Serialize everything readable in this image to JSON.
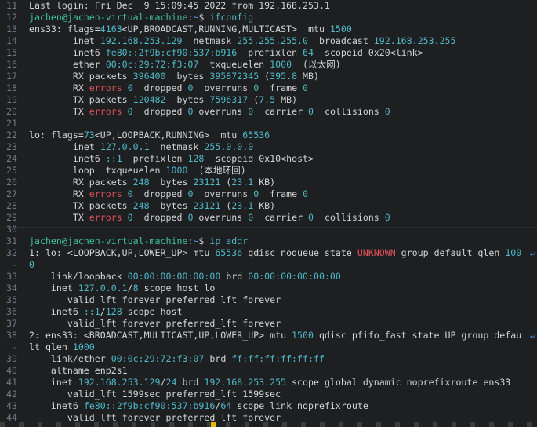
{
  "terminal": {
    "lines": [
      {
        "n": "11",
        "segs": [
          {
            "t": "Last login: Fri Dec  9 15:09:45 2022 from 192.168.253.1"
          }
        ]
      },
      {
        "n": "12",
        "segs": [
          {
            "t": "jachen@jachen-virtual-machine",
            "c": "p"
          },
          {
            "t": ":",
            "c": "sym"
          },
          {
            "t": "~",
            "c": "dir"
          },
          {
            "t": "$ ",
            "c": "sym"
          },
          {
            "t": "ifconfig",
            "c": "n"
          }
        ]
      },
      {
        "n": "13",
        "segs": [
          {
            "t": "ens33: flags="
          },
          {
            "t": "4163",
            "c": "n"
          },
          {
            "t": "<UP,BROADCAST,RUNNING,MULTICAST>  mtu "
          },
          {
            "t": "1500",
            "c": "n"
          }
        ]
      },
      {
        "n": "14",
        "segs": [
          {
            "t": "        inet "
          },
          {
            "t": "192.168.253.129",
            "c": "n"
          },
          {
            "t": "  netmask "
          },
          {
            "t": "255.255.255.0",
            "c": "n"
          },
          {
            "t": "  broadcast "
          },
          {
            "t": "192.168.253.255",
            "c": "n"
          }
        ]
      },
      {
        "n": "15",
        "segs": [
          {
            "t": "        inet6 "
          },
          {
            "t": "fe80::2f9b:cf90:537:b916",
            "c": "n"
          },
          {
            "t": "  prefixlen "
          },
          {
            "t": "64",
            "c": "n"
          },
          {
            "t": "  scopeid 0x20<link>"
          }
        ]
      },
      {
        "n": "16",
        "segs": [
          {
            "t": "        ether "
          },
          {
            "t": "00:0c:29:72:f3:07",
            "c": "n"
          },
          {
            "t": "  txqueuelen "
          },
          {
            "t": "1000",
            "c": "n"
          },
          {
            "t": "  (以太网)"
          }
        ]
      },
      {
        "n": "17",
        "segs": [
          {
            "t": "        RX packets "
          },
          {
            "t": "396400",
            "c": "n"
          },
          {
            "t": "  bytes "
          },
          {
            "t": "395872345",
            "c": "n"
          },
          {
            "t": " ("
          },
          {
            "t": "395.8",
            "c": "n"
          },
          {
            "t": " MB)"
          }
        ]
      },
      {
        "n": "18",
        "segs": [
          {
            "t": "        RX "
          },
          {
            "t": "errors",
            "c": "r"
          },
          {
            "t": " "
          },
          {
            "t": "0",
            "c": "n"
          },
          {
            "t": "  dropped "
          },
          {
            "t": "0",
            "c": "n"
          },
          {
            "t": "  overruns "
          },
          {
            "t": "0",
            "c": "n"
          },
          {
            "t": "  frame "
          },
          {
            "t": "0",
            "c": "n"
          }
        ]
      },
      {
        "n": "19",
        "segs": [
          {
            "t": "        TX packets "
          },
          {
            "t": "120482",
            "c": "n"
          },
          {
            "t": "  bytes "
          },
          {
            "t": "7596317",
            "c": "n"
          },
          {
            "t": " ("
          },
          {
            "t": "7.5",
            "c": "n"
          },
          {
            "t": " MB)"
          }
        ]
      },
      {
        "n": "20",
        "segs": [
          {
            "t": "        TX "
          },
          {
            "t": "errors",
            "c": "r"
          },
          {
            "t": " "
          },
          {
            "t": "0",
            "c": "n"
          },
          {
            "t": "  dropped "
          },
          {
            "t": "0",
            "c": "n"
          },
          {
            "t": " overruns "
          },
          {
            "t": "0",
            "c": "n"
          },
          {
            "t": "  carrier "
          },
          {
            "t": "0",
            "c": "n"
          },
          {
            "t": "  collisions "
          },
          {
            "t": "0",
            "c": "n"
          }
        ]
      },
      {
        "n": "21",
        "segs": []
      },
      {
        "n": "22",
        "segs": [
          {
            "t": "lo: flags="
          },
          {
            "t": "73",
            "c": "n"
          },
          {
            "t": "<UP,LOOPBACK,RUNNING>  mtu "
          },
          {
            "t": "65536",
            "c": "n"
          }
        ]
      },
      {
        "n": "23",
        "segs": [
          {
            "t": "        inet "
          },
          {
            "t": "127.0.0.1",
            "c": "n"
          },
          {
            "t": "  netmask "
          },
          {
            "t": "255.0.0.0",
            "c": "n"
          }
        ]
      },
      {
        "n": "24",
        "segs": [
          {
            "t": "        inet6 "
          },
          {
            "t": "::1",
            "c": "n"
          },
          {
            "t": "  prefixlen "
          },
          {
            "t": "128",
            "c": "n"
          },
          {
            "t": "  scopeid 0x10<host>"
          }
        ]
      },
      {
        "n": "25",
        "segs": [
          {
            "t": "        loop  txqueuelen "
          },
          {
            "t": "1000",
            "c": "n"
          },
          {
            "t": "  (本地环回)"
          }
        ]
      },
      {
        "n": "26",
        "segs": [
          {
            "t": "        RX packets "
          },
          {
            "t": "248",
            "c": "n"
          },
          {
            "t": "  bytes "
          },
          {
            "t": "23121",
            "c": "n"
          },
          {
            "t": " ("
          },
          {
            "t": "23.1",
            "c": "n"
          },
          {
            "t": " KB)"
          }
        ]
      },
      {
        "n": "27",
        "segs": [
          {
            "t": "        RX "
          },
          {
            "t": "errors",
            "c": "r"
          },
          {
            "t": " "
          },
          {
            "t": "0",
            "c": "n"
          },
          {
            "t": "  dropped "
          },
          {
            "t": "0",
            "c": "n"
          },
          {
            "t": "  overruns "
          },
          {
            "t": "0",
            "c": "n"
          },
          {
            "t": "  frame "
          },
          {
            "t": "0",
            "c": "n"
          }
        ]
      },
      {
        "n": "28",
        "segs": [
          {
            "t": "        TX packets "
          },
          {
            "t": "248",
            "c": "n"
          },
          {
            "t": "  bytes "
          },
          {
            "t": "23121",
            "c": "n"
          },
          {
            "t": " ("
          },
          {
            "t": "23.1",
            "c": "n"
          },
          {
            "t": " KB)"
          }
        ]
      },
      {
        "n": "29",
        "segs": [
          {
            "t": "        TX "
          },
          {
            "t": "errors",
            "c": "r"
          },
          {
            "t": " "
          },
          {
            "t": "0",
            "c": "n"
          },
          {
            "t": "  dropped "
          },
          {
            "t": "0",
            "c": "n"
          },
          {
            "t": " overruns "
          },
          {
            "t": "0",
            "c": "n"
          },
          {
            "t": "  carrier "
          },
          {
            "t": "0",
            "c": "n"
          },
          {
            "t": "  collisions "
          },
          {
            "t": "0",
            "c": "n"
          }
        ]
      },
      {
        "n": "30",
        "segs": []
      },
      {
        "n": "31",
        "segs": [
          {
            "t": "jachen@jachen-virtual-machine",
            "c": "p"
          },
          {
            "t": ":",
            "c": "sym"
          },
          {
            "t": "~",
            "c": "dir"
          },
          {
            "t": "$ ",
            "c": "sym"
          },
          {
            "t": "ip addr",
            "c": "n"
          }
        ]
      },
      {
        "n": "32",
        "segs": [
          {
            "t": "1: lo: <LOOPBACK,UP,LOWER_UP> mtu "
          },
          {
            "t": "65536",
            "c": "n"
          },
          {
            "t": " qdisc noqueue state "
          },
          {
            "t": "UNKNOWN",
            "c": "r"
          },
          {
            "t": " group default qlen "
          },
          {
            "t": "100",
            "c": "n"
          }
        ],
        "wrap": true
      },
      {
        "n": "-",
        "segs": [
          {
            "t": "0",
            "c": "n"
          }
        ]
      },
      {
        "n": "33",
        "segs": [
          {
            "t": "    link/loopback "
          },
          {
            "t": "00:00:00:00:00:00",
            "c": "n"
          },
          {
            "t": " brd "
          },
          {
            "t": "00:00:00:00:00:00",
            "c": "n"
          }
        ]
      },
      {
        "n": "34",
        "segs": [
          {
            "t": "    inet "
          },
          {
            "t": "127.0.0.1",
            "c": "n"
          },
          {
            "t": "/"
          },
          {
            "t": "8",
            "c": "n"
          },
          {
            "t": " scope host lo"
          }
        ]
      },
      {
        "n": "35",
        "segs": [
          {
            "t": "       valid_lft forever preferred_lft forever"
          }
        ]
      },
      {
        "n": "36",
        "segs": [
          {
            "t": "    inet6 "
          },
          {
            "t": "::1",
            "c": "n"
          },
          {
            "t": "/"
          },
          {
            "t": "128",
            "c": "n"
          },
          {
            "t": " scope host"
          }
        ]
      },
      {
        "n": "37",
        "segs": [
          {
            "t": "       valid_lft forever preferred_lft forever"
          }
        ]
      },
      {
        "n": "38",
        "segs": [
          {
            "t": "2: ens33: <BROADCAST,MULTICAST,UP,LOWER_UP> mtu "
          },
          {
            "t": "1500",
            "c": "n"
          },
          {
            "t": " qdisc pfifo_fast state UP group defau"
          }
        ],
        "wrap": true
      },
      {
        "n": "-",
        "segs": [
          {
            "t": "lt qlen "
          },
          {
            "t": "1000",
            "c": "n"
          }
        ]
      },
      {
        "n": "39",
        "segs": [
          {
            "t": "    link/ether "
          },
          {
            "t": "00:0c:29:72:f3:07",
            "c": "n"
          },
          {
            "t": " brd "
          },
          {
            "t": "ff:ff:ff:ff:ff:ff",
            "c": "n"
          }
        ]
      },
      {
        "n": "40",
        "segs": [
          {
            "t": "    altname enp2s1"
          }
        ]
      },
      {
        "n": "41",
        "segs": [
          {
            "t": "    inet "
          },
          {
            "t": "192.168.253.129",
            "c": "n"
          },
          {
            "t": "/"
          },
          {
            "t": "24",
            "c": "n"
          },
          {
            "t": " brd "
          },
          {
            "t": "192.168.253.255",
            "c": "n"
          },
          {
            "t": " scope global dynamic noprefixroute ens33"
          }
        ]
      },
      {
        "n": "42",
        "segs": [
          {
            "t": "       valid_lft 1599sec preferred_lft 1599sec"
          }
        ]
      },
      {
        "n": "43",
        "segs": [
          {
            "t": "    inet6 "
          },
          {
            "t": "fe80::2f9b:cf90:537:b916",
            "c": "n"
          },
          {
            "t": "/"
          },
          {
            "t": "64",
            "c": "n"
          },
          {
            "t": " scope link noprefixroute"
          }
        ]
      },
      {
        "n": "44",
        "segs": [
          {
            "t": "       valid_lft forever preferred_lft forever"
          }
        ]
      }
    ]
  }
}
